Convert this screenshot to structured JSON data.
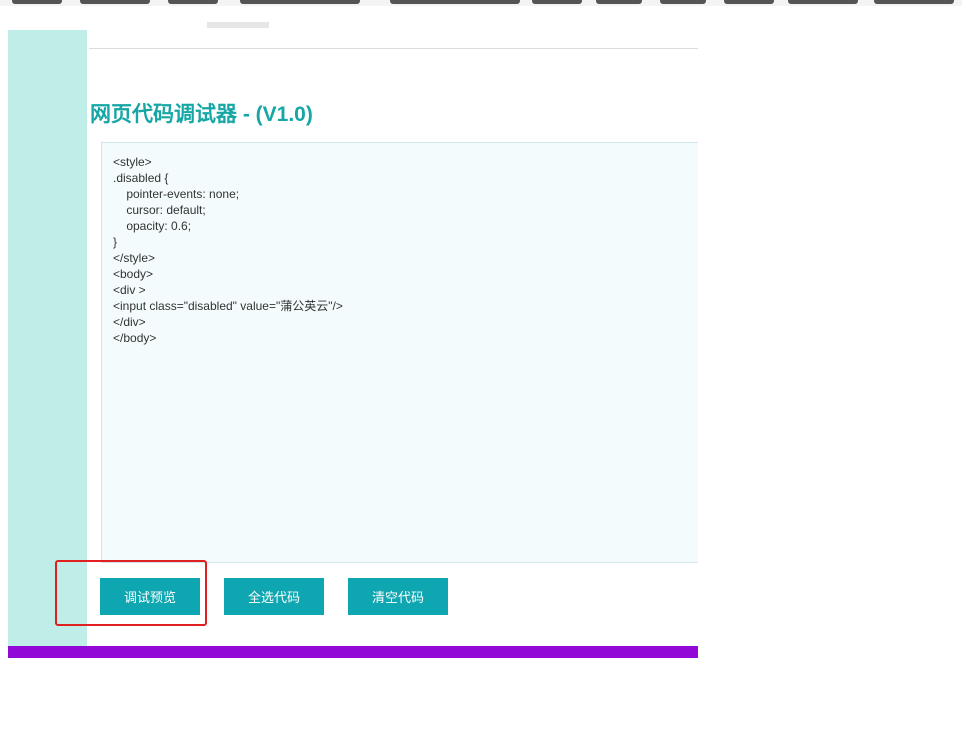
{
  "page": {
    "title": "网页代码调试器 - (V1.0)"
  },
  "editor": {
    "code": "<style>\n.disabled {\n    pointer-events: none;\n    cursor: default;\n    opacity: 0.6;\n}\n</style>\n<body>\n<div >\n<input class=\"disabled\" value=\"蒲公英云\"/>\n</div>\n</body>"
  },
  "buttons": {
    "preview": "调试预览",
    "select_all": "全选代码",
    "clear": "清空代码"
  },
  "colors": {
    "title": "#17a6a6",
    "button": "#0ea6b0",
    "left_band": "#bfeee8",
    "bottom_bar": "#9208d6",
    "highlight": "#e02020"
  }
}
